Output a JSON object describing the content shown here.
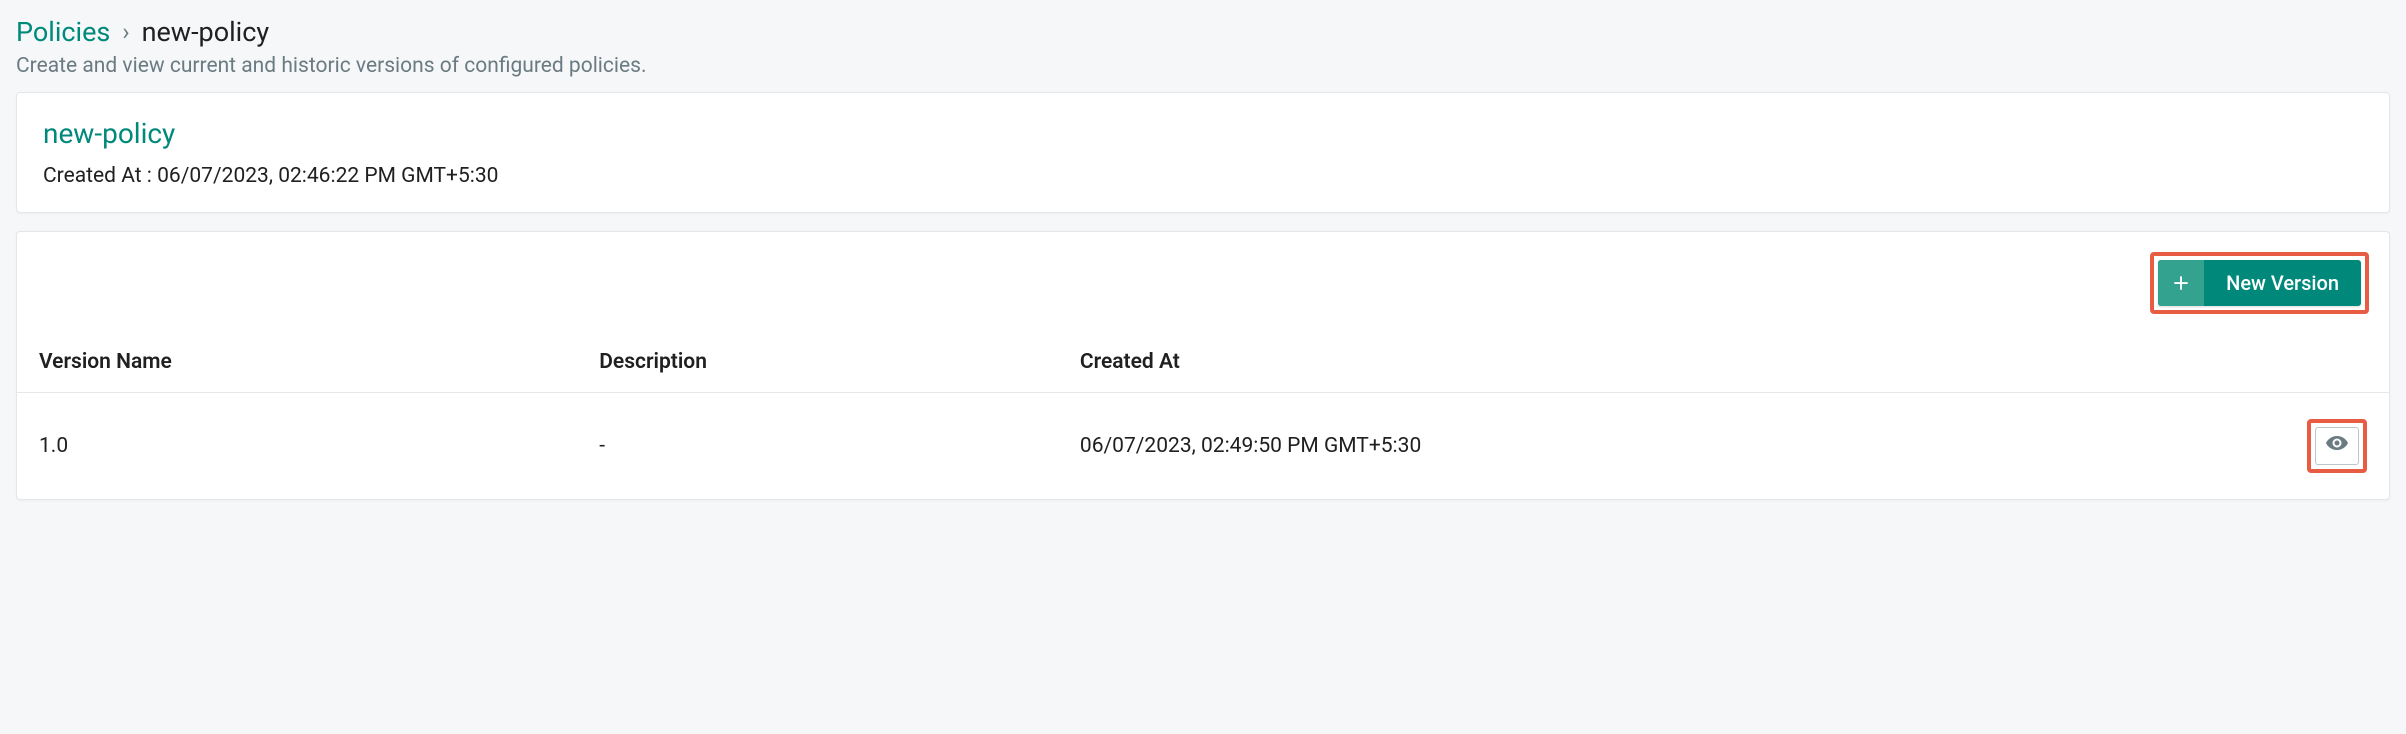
{
  "breadcrumb": {
    "root": "Policies",
    "separator": "›",
    "current": "new-policy"
  },
  "subheading": "Create and view current and historic versions of configured policies.",
  "policy": {
    "title": "new-policy",
    "created_at_label": "Created At : 06/07/2023, 02:46:22 PM GMT+5:30"
  },
  "toolbar": {
    "new_version_label": "New Version"
  },
  "columns": {
    "version_name": "Version Name",
    "description": "Description",
    "created_at": "Created At"
  },
  "rows": [
    {
      "version_name": "1.0",
      "description": "-",
      "created_at": "06/07/2023, 02:49:50 PM GMT+5:30"
    }
  ]
}
